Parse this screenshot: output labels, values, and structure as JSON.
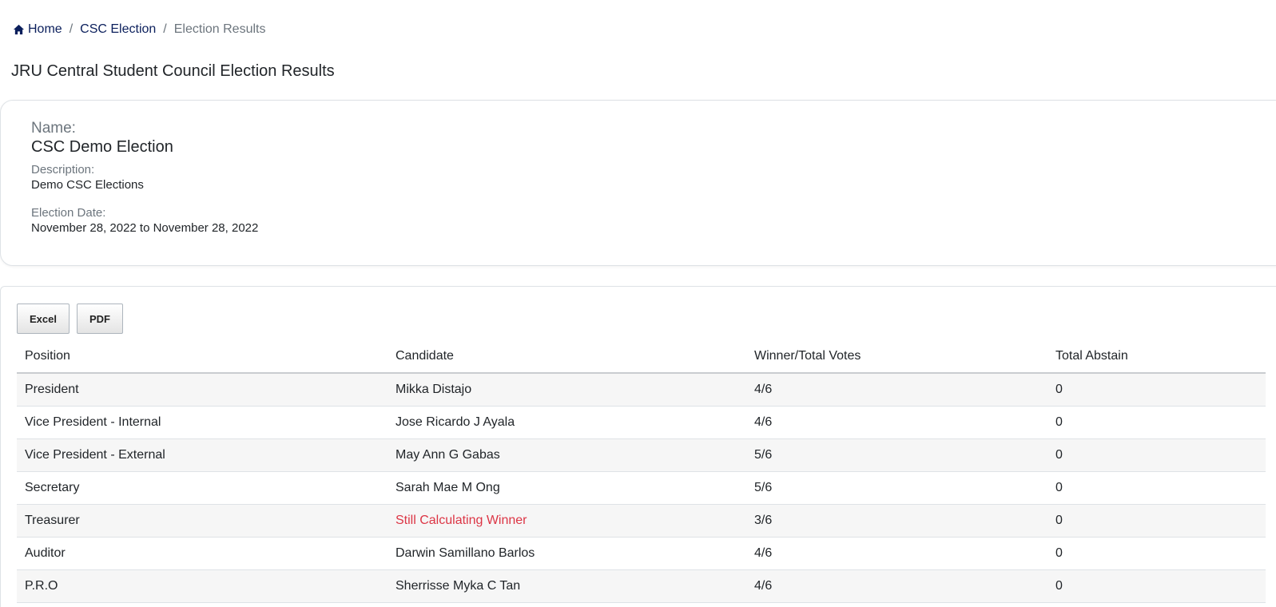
{
  "breadcrumb": {
    "home": "Home",
    "election": "CSC Election",
    "current": "Election Results",
    "separator": "/"
  },
  "page_title": "JRU Central Student Council Election Results",
  "election": {
    "name_label": "Name:",
    "name": "CSC Demo Election",
    "description_label": "Description:",
    "description": "Demo CSC Elections",
    "date_label": "Election Date:",
    "date": "November 28, 2022 to November 28, 2022"
  },
  "export": {
    "excel_label": "Excel",
    "pdf_label": "PDF"
  },
  "table": {
    "headers": [
      "Position",
      "Candidate",
      "Winner/Total Votes",
      "Total Abstain"
    ],
    "rows": [
      {
        "position": "President",
        "candidate": "Mikka Distajo",
        "votes": "4/6",
        "abstain": "0",
        "pending": false
      },
      {
        "position": "Vice President - Internal",
        "candidate": "Jose Ricardo J Ayala",
        "votes": "4/6",
        "abstain": "0",
        "pending": false
      },
      {
        "position": "Vice President - External",
        "candidate": "May Ann G Gabas",
        "votes": "5/6",
        "abstain": "0",
        "pending": false
      },
      {
        "position": "Secretary",
        "candidate": "Sarah Mae M Ong",
        "votes": "5/6",
        "abstain": "0",
        "pending": false
      },
      {
        "position": "Treasurer",
        "candidate": "Still Calculating Winner",
        "votes": "3/6",
        "abstain": "0",
        "pending": true
      },
      {
        "position": "Auditor",
        "candidate": "Darwin Samillano Barlos",
        "votes": "4/6",
        "abstain": "0",
        "pending": false
      },
      {
        "position": "P.R.O",
        "candidate": "Sherrisse Myka C Tan",
        "votes": "4/6",
        "abstain": "0",
        "pending": false
      }
    ]
  },
  "colors": {
    "link": "#0b1f5c",
    "muted": "#6c757d",
    "pending": "#dc3545"
  }
}
